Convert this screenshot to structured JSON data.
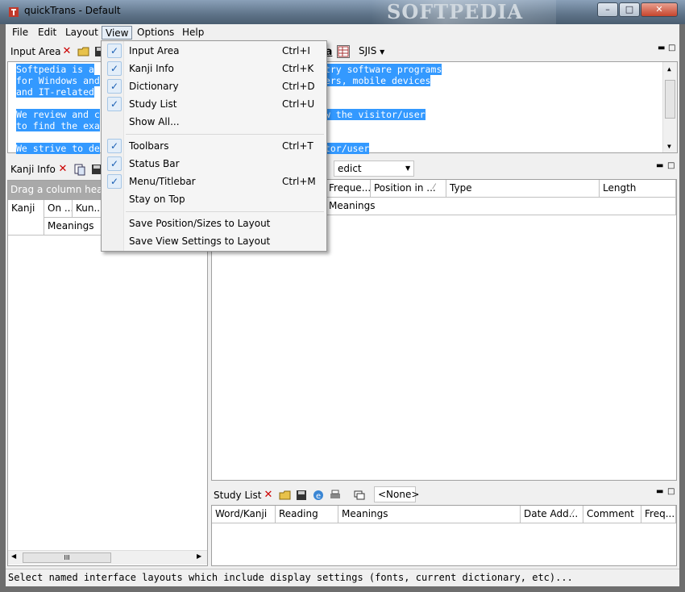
{
  "window": {
    "title": "quickTrans - Default",
    "watermark": "SOFTPEDIA",
    "controls": {
      "minimize": "–",
      "maximize": "□",
      "close": "✕"
    }
  },
  "menubar": [
    "File",
    "Edit",
    "Layout",
    "View",
    "Options",
    "Help"
  ],
  "view_menu": {
    "items": [
      {
        "label": "Input Area",
        "shortcut": "Ctrl+I"
      },
      {
        "label": "Kanji Info",
        "shortcut": "Ctrl+K"
      },
      {
        "label": "Dictionary",
        "shortcut": "Ctrl+D"
      },
      {
        "label": "Study List",
        "shortcut": "Ctrl+U"
      },
      {
        "label": "Show All..."
      },
      {
        "label": "Toolbars",
        "shortcut": "Ctrl+T"
      },
      {
        "label": "Status Bar"
      },
      {
        "label": "Menu/Titlebar",
        "shortcut": "Ctrl+M"
      },
      {
        "label": "Stay on Top"
      },
      {
        "label": "Save Position/Sizes to Layout"
      },
      {
        "label": "Save View Settings to Layout"
      }
    ],
    "checkmark": "✓"
  },
  "input_area": {
    "label": "Input Area",
    "encoding": "SJIS",
    "left_lines": [
      "Softpedia is a",
      "for Windows and",
      "and IT-related",
      "",
      "We review and c",
      "to find the exa",
      "",
      "We strive to de"
    ],
    "right_lines": [
      "-try software programs",
      "vers, mobile devices",
      "",
      "",
      "ow the visitor/user",
      "",
      "",
      "itor/user"
    ]
  },
  "kanji_info": {
    "label": "Kanji Info",
    "group_hint": "Drag a column hea",
    "columns": [
      "Kanji",
      "On ...",
      "Kun...",
      "Meanings"
    ],
    "hscroll_grip": "III"
  },
  "dictionary": {
    "dict_select": "edict",
    "columns": [
      "Freque...",
      "Position in ...",
      "Type",
      "Length"
    ],
    "subcolumn": "Meanings"
  },
  "study_list": {
    "label": "Study List",
    "filter": "<None>",
    "columns": [
      "Word/Kanji",
      "Reading",
      "Meanings",
      "Date Add...",
      "Comment",
      "Freq..."
    ]
  },
  "status_bar": {
    "text": "Select named interface layouts which include display settings (fonts, current dictionary, etc)..."
  },
  "colors": {
    "selection": "#3399ff",
    "menu_background": "#f5f5f5",
    "panel_background": "#f0f0f0",
    "group_band": "#a9a9a9"
  }
}
